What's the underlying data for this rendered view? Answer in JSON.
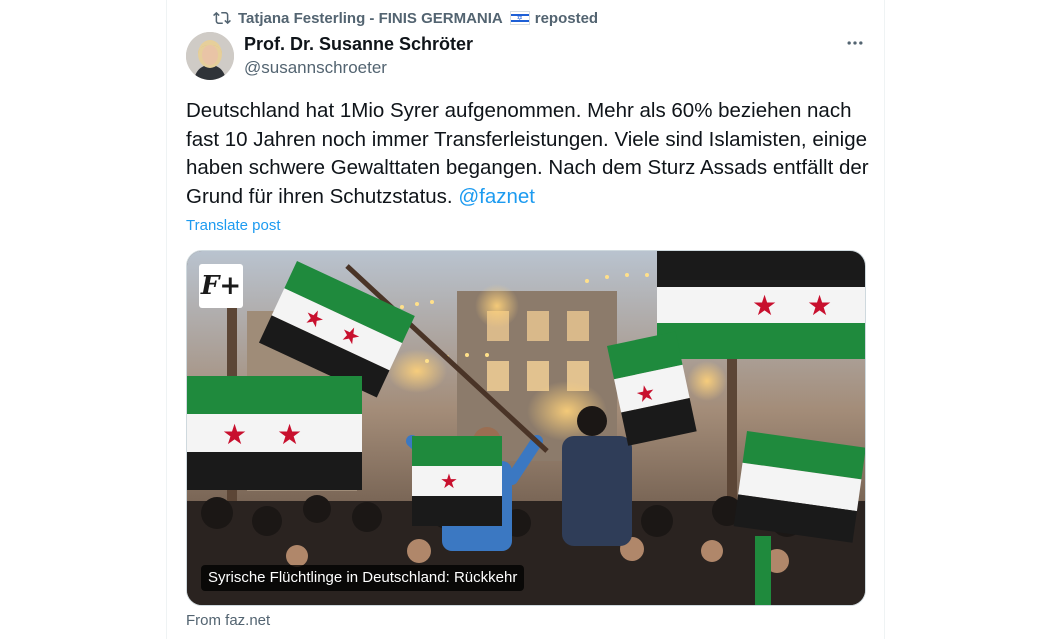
{
  "repost": {
    "text": "Tatjana Festerling - FINIS GERMANIA",
    "suffix": "reposted",
    "flag_icon": "israel-flag-emoji"
  },
  "author": {
    "name": "Prof. Dr. Susanne Schröter",
    "handle": "@susannschroeter"
  },
  "post": {
    "text": "Deutschland hat 1Mio Syrer aufgenommen. Mehr als 60% beziehen nach fast 10 Jahren noch immer Transferleistungen. Viele sind Islamisten, einige haben schwere Gewalttaten begangen. Nach dem Sturz Assads entfällt der Grund für ihren Schutzstatus. ",
    "mention": "@faznet",
    "translate_label": "Translate post"
  },
  "card": {
    "badge": "F+",
    "caption": "Syrische Flüchtlinge in Deutschland: Rückkehr",
    "source": "From faz.net"
  },
  "colors": {
    "accent": "#1d9bf0",
    "secondary_text": "#536471",
    "primary_text": "#0f1419"
  }
}
